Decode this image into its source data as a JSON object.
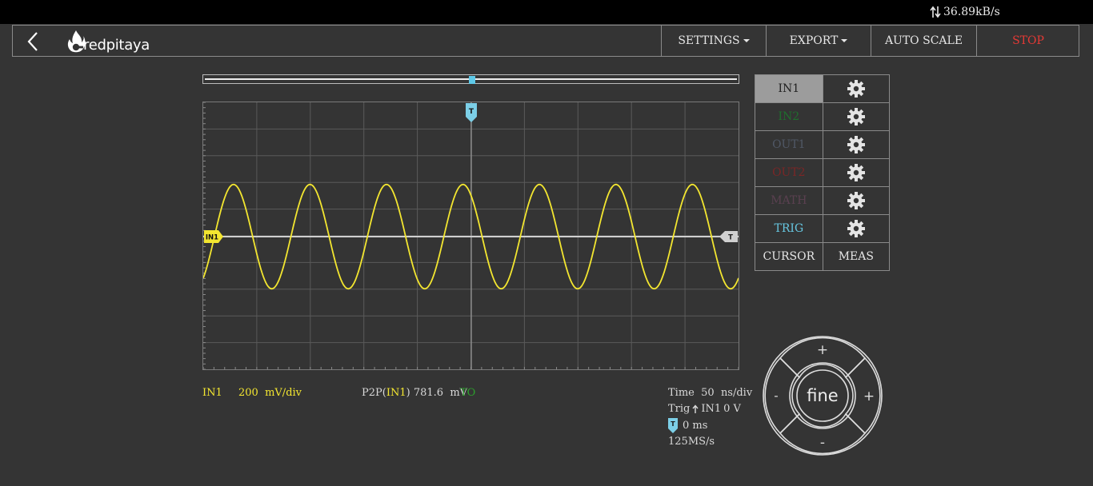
{
  "status": {
    "rate": "36.89kB/s"
  },
  "nav": {
    "logo_text": "redpitaya",
    "settings": "SETTINGS",
    "export": "EXPORT",
    "auto_scale": "AUTO SCALE",
    "stop": "STOP"
  },
  "channels": [
    {
      "label": "IN1",
      "color": "#222222",
      "active": true
    },
    {
      "label": "IN2",
      "color": "#1f6e2d"
    },
    {
      "label": "OUT1",
      "color": "#505866"
    },
    {
      "label": "OUT2",
      "color": "#7a2626"
    },
    {
      "label": "MATH",
      "color": "#5a4050"
    },
    {
      "label": "TRIG",
      "color": "#66c6e0"
    }
  ],
  "tools": {
    "cursor": "CURSOR",
    "meas": "MEAS"
  },
  "markers": {
    "trigger": "T",
    "channel": "IN1",
    "level": "T"
  },
  "signal": {
    "color": "#f3e630",
    "cycles": 7,
    "peak_to_peak_mV": 781.6
  },
  "readout": {
    "channel": "IN1",
    "scale_value": "200",
    "scale_unit": "mV/div",
    "p2p_prefix": "P2P(",
    "p2p_channel": "IN1",
    "p2p_suffix": ")",
    "p2p_value": "781.6",
    "p2p_unit": "mV",
    "mode": "TO",
    "time_label": "Time",
    "time_value": "50",
    "time_unit": "ns/div",
    "trig_label": "Trig",
    "trig_source": "IN1",
    "trig_level": "0 V",
    "trig_delay": "0 ms",
    "sample_rate": "125MS/s"
  },
  "dpad": {
    "up": "+",
    "down": "-",
    "left": "-",
    "right": "+",
    "center": "fine"
  }
}
